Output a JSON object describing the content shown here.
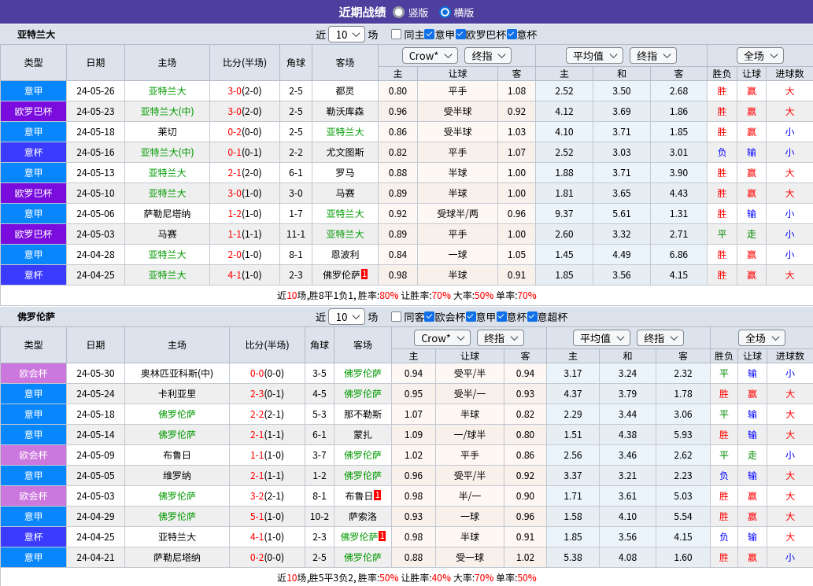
{
  "title_bar": {
    "title": "近期战绩",
    "radio_vertical": "竖版",
    "radio_horizontal": "横版",
    "selected": "横版"
  },
  "sections": [
    {
      "team": "亚特兰大",
      "recent_label": "近",
      "recent_count": "10",
      "matches_label": "场",
      "filters": [
        {
          "label": "同主",
          "checked": false
        },
        {
          "label": "意甲",
          "checked": true
        },
        {
          "label": "欧罗巴杯",
          "checked": true
        },
        {
          "label": "意杯",
          "checked": true
        }
      ],
      "columns": [
        "类型",
        "日期",
        "主场",
        "比分(半场)",
        "角球",
        "客场"
      ],
      "odds_dropdowns": [
        "Crow*",
        "终指"
      ],
      "avg_dropdowns": [
        "平均值",
        "终指"
      ],
      "scope_dropdown": "全场",
      "sub_columns": [
        "主",
        "让球",
        "客",
        "主",
        "和",
        "客",
        "胜负",
        "让球",
        "进球数"
      ],
      "rows": [
        {
          "type": "意甲",
          "type_color": "#0887FC",
          "date": "24-05-26",
          "home": "亚特兰大",
          "home_hl": true,
          "score": "3-0",
          "half": "(2-0)",
          "corner": "2-5",
          "away": "都灵",
          "away_hl": false,
          "odds": [
            "0.80",
            "平手",
            "1.08"
          ],
          "avg": [
            "2.52",
            "3.50",
            "2.68"
          ],
          "result": [
            "胜",
            "赢",
            "大"
          ],
          "result_colors": [
            "#FF0000",
            "#FF0000",
            "#FF0000"
          ]
        },
        {
          "type": "欧罗巴杯",
          "type_color": "#7A0CDE",
          "date": "24-05-23",
          "home": "亚特兰大(中)",
          "home_hl": true,
          "score": "3-0",
          "half": "(2-0)",
          "corner": "2-5",
          "away": "勒沃库森",
          "away_hl": false,
          "odds": [
            "0.96",
            "受半球",
            "0.92"
          ],
          "avg": [
            "4.12",
            "3.69",
            "1.86"
          ],
          "result": [
            "胜",
            "赢",
            "大"
          ],
          "result_colors": [
            "#FF0000",
            "#FF0000",
            "#FF0000"
          ]
        },
        {
          "type": "意甲",
          "type_color": "#0887FC",
          "date": "24-05-18",
          "home": "莱切",
          "home_hl": false,
          "score": "0-2",
          "half": "(0-0)",
          "corner": "2-5",
          "away": "亚特兰大",
          "away_hl": true,
          "odds": [
            "0.86",
            "受半球",
            "1.03"
          ],
          "avg": [
            "4.10",
            "3.71",
            "1.85"
          ],
          "result": [
            "胜",
            "赢",
            "小"
          ],
          "result_colors": [
            "#FF0000",
            "#FF0000",
            "#0000FF"
          ]
        },
        {
          "type": "意杯",
          "type_color": "#3B3BFE",
          "date": "24-05-16",
          "home": "亚特兰大(中)",
          "home_hl": true,
          "score": "0-1",
          "half": "(0-1)",
          "corner": "2-2",
          "away": "尤文图斯",
          "away_hl": false,
          "odds": [
            "0.82",
            "平手",
            "1.07"
          ],
          "avg": [
            "2.52",
            "3.03",
            "3.01"
          ],
          "result": [
            "负",
            "输",
            "小"
          ],
          "result_colors": [
            "#0000FF",
            "#0000FF",
            "#0000FF"
          ]
        },
        {
          "type": "意甲",
          "type_color": "#0887FC",
          "date": "24-05-13",
          "home": "亚特兰大",
          "home_hl": true,
          "score": "2-1",
          "half": "(2-0)",
          "corner": "6-1",
          "away": "罗马",
          "away_hl": false,
          "odds": [
            "0.88",
            "半球",
            "1.00"
          ],
          "avg": [
            "1.88",
            "3.71",
            "3.90"
          ],
          "result": [
            "胜",
            "赢",
            "大"
          ],
          "result_colors": [
            "#FF0000",
            "#FF0000",
            "#FF0000"
          ]
        },
        {
          "type": "欧罗巴杯",
          "type_color": "#7A0CDE",
          "date": "24-05-10",
          "home": "亚特兰大",
          "home_hl": true,
          "score": "3-0",
          "half": "(1-0)",
          "corner": "3-0",
          "away": "马赛",
          "away_hl": false,
          "odds": [
            "0.89",
            "半球",
            "1.00"
          ],
          "avg": [
            "1.81",
            "3.65",
            "4.43"
          ],
          "result": [
            "胜",
            "赢",
            "大"
          ],
          "result_colors": [
            "#FF0000",
            "#FF0000",
            "#FF0000"
          ]
        },
        {
          "type": "意甲",
          "type_color": "#0887FC",
          "date": "24-05-06",
          "home": "萨勒尼塔纳",
          "home_hl": false,
          "score": "1-2",
          "half": "(1-0)",
          "corner": "1-7",
          "away": "亚特兰大",
          "away_hl": true,
          "odds": [
            "0.92",
            "受球半/两",
            "0.96"
          ],
          "avg": [
            "9.37",
            "5.61",
            "1.31"
          ],
          "result": [
            "胜",
            "输",
            "小"
          ],
          "result_colors": [
            "#FF0000",
            "#0000FF",
            "#0000FF"
          ]
        },
        {
          "type": "欧罗巴杯",
          "type_color": "#7A0CDE",
          "date": "24-05-03",
          "home": "马赛",
          "home_hl": false,
          "score": "1-1",
          "half": "(1-1)",
          "corner": "11-1",
          "away": "亚特兰大",
          "away_hl": true,
          "odds": [
            "0.89",
            "平手",
            "1.00"
          ],
          "avg": [
            "2.60",
            "3.32",
            "2.71"
          ],
          "result": [
            "平",
            "走",
            "小"
          ],
          "result_colors": [
            "#008800",
            "#008800",
            "#0000FF"
          ]
        },
        {
          "type": "意甲",
          "type_color": "#0887FC",
          "date": "24-04-28",
          "home": "亚特兰大",
          "home_hl": true,
          "score": "2-0",
          "half": "(1-0)",
          "corner": "8-1",
          "away": "恩波利",
          "away_hl": false,
          "odds": [
            "0.84",
            "一球",
            "1.05"
          ],
          "avg": [
            "1.45",
            "4.49",
            "6.86"
          ],
          "result": [
            "胜",
            "赢",
            "小"
          ],
          "result_colors": [
            "#FF0000",
            "#FF0000",
            "#0000FF"
          ]
        },
        {
          "type": "意杯",
          "type_color": "#3B3BFE",
          "date": "24-04-25",
          "home": "亚特兰大",
          "home_hl": true,
          "score": "4-1",
          "half": "(1-0)",
          "corner": "2-3",
          "away": "佛罗伦萨",
          "away_hl": false,
          "away_badge": "1",
          "odds": [
            "0.98",
            "半球",
            "0.91"
          ],
          "avg": [
            "1.85",
            "3.56",
            "4.15"
          ],
          "result": [
            "胜",
            "赢",
            "大"
          ],
          "result_colors": [
            "#FF0000",
            "#FF0000",
            "#FF0000"
          ]
        }
      ],
      "summary": [
        {
          "text": "近",
          "color": "#000000"
        },
        {
          "text": "10",
          "color": "#FF0000"
        },
        {
          "text": "场,胜8平1负1, 胜率:",
          "color": "#000000"
        },
        {
          "text": "80%",
          "color": "#FF0000"
        },
        {
          "text": " 让胜率:",
          "color": "#000000"
        },
        {
          "text": "70%",
          "color": "#FF0000"
        },
        {
          "text": " 大率:",
          "color": "#000000"
        },
        {
          "text": "50%",
          "color": "#FF0000"
        },
        {
          "text": " 单率:",
          "color": "#000000"
        },
        {
          "text": "70%",
          "color": "#FF0000"
        }
      ]
    },
    {
      "team": "佛罗伦萨",
      "recent_label": "近",
      "recent_count": "10",
      "matches_label": "场",
      "filters": [
        {
          "label": "同客",
          "checked": false
        },
        {
          "label": "欧会杯",
          "checked": true
        },
        {
          "label": "意甲",
          "checked": true
        },
        {
          "label": "意杯",
          "checked": true
        },
        {
          "label": "意超杯",
          "checked": true
        }
      ],
      "columns": [
        "类型",
        "日期",
        "主场",
        "比分(半场)",
        "角球",
        "客场"
      ],
      "odds_dropdowns": [
        "Crow*",
        "终指"
      ],
      "avg_dropdowns": [
        "平均值",
        "终指"
      ],
      "scope_dropdown": "全场",
      "sub_columns": [
        "主",
        "让球",
        "客",
        "主",
        "和",
        "客",
        "胜负",
        "让球",
        "进球数"
      ],
      "rows": [
        {
          "type": "欧会杯",
          "type_color": "#CC77DD",
          "date": "24-05-30",
          "home": "奥林匹亚科斯(中)",
          "home_hl": false,
          "score": "0-0",
          "half": "(0-0)",
          "corner": "3-5",
          "away": "佛罗伦萨",
          "away_hl": true,
          "odds": [
            "0.94",
            "受平/半",
            "0.94"
          ],
          "avg": [
            "3.17",
            "3.24",
            "2.32"
          ],
          "result": [
            "平",
            "输",
            "小"
          ],
          "result_colors": [
            "#008800",
            "#0000FF",
            "#0000FF"
          ]
        },
        {
          "type": "意甲",
          "type_color": "#0887FC",
          "date": "24-05-24",
          "home": "卡利亚里",
          "home_hl": false,
          "score": "2-3",
          "half": "(0-1)",
          "corner": "4-5",
          "away": "佛罗伦萨",
          "away_hl": true,
          "odds": [
            "0.95",
            "受半/一",
            "0.93"
          ],
          "avg": [
            "4.37",
            "3.79",
            "1.78"
          ],
          "result": [
            "胜",
            "赢",
            "大"
          ],
          "result_colors": [
            "#FF0000",
            "#FF0000",
            "#FF0000"
          ]
        },
        {
          "type": "意甲",
          "type_color": "#0887FC",
          "date": "24-05-18",
          "home": "佛罗伦萨",
          "home_hl": true,
          "score": "2-2",
          "half": "(2-1)",
          "corner": "5-3",
          "away": "那不勒斯",
          "away_hl": false,
          "odds": [
            "1.07",
            "半球",
            "0.82"
          ],
          "avg": [
            "2.29",
            "3.44",
            "3.06"
          ],
          "result": [
            "平",
            "输",
            "大"
          ],
          "result_colors": [
            "#008800",
            "#0000FF",
            "#FF0000"
          ]
        },
        {
          "type": "意甲",
          "type_color": "#0887FC",
          "date": "24-05-14",
          "home": "佛罗伦萨",
          "home_hl": true,
          "score": "2-1",
          "half": "(1-1)",
          "corner": "6-1",
          "away": "蒙扎",
          "away_hl": false,
          "odds": [
            "1.09",
            "一/球半",
            "0.80"
          ],
          "avg": [
            "1.51",
            "4.38",
            "5.93"
          ],
          "result": [
            "胜",
            "输",
            "大"
          ],
          "result_colors": [
            "#FF0000",
            "#0000FF",
            "#FF0000"
          ]
        },
        {
          "type": "欧会杯",
          "type_color": "#CC77DD",
          "date": "24-05-09",
          "home": "布鲁日",
          "home_hl": false,
          "score": "1-1",
          "half": "(1-0)",
          "corner": "3-7",
          "away": "佛罗伦萨",
          "away_hl": true,
          "odds": [
            "1.02",
            "平手",
            "0.86"
          ],
          "avg": [
            "2.56",
            "3.46",
            "2.62"
          ],
          "result": [
            "平",
            "走",
            "小"
          ],
          "result_colors": [
            "#008800",
            "#008800",
            "#0000FF"
          ]
        },
        {
          "type": "意甲",
          "type_color": "#0887FC",
          "date": "24-05-05",
          "home": "维罗纳",
          "home_hl": false,
          "score": "2-1",
          "half": "(1-1)",
          "corner": "1-2",
          "away": "佛罗伦萨",
          "away_hl": true,
          "odds": [
            "0.96",
            "受平/半",
            "0.92"
          ],
          "avg": [
            "3.37",
            "3.21",
            "2.23"
          ],
          "result": [
            "负",
            "输",
            "大"
          ],
          "result_colors": [
            "#0000FF",
            "#0000FF",
            "#FF0000"
          ]
        },
        {
          "type": "欧会杯",
          "type_color": "#CC77DD",
          "date": "24-05-03",
          "home": "佛罗伦萨",
          "home_hl": true,
          "score": "3-2",
          "half": "(2-1)",
          "corner": "8-1",
          "away": "布鲁日",
          "away_hl": false,
          "away_badge": "1",
          "odds": [
            "0.98",
            "半/一",
            "0.90"
          ],
          "avg": [
            "1.71",
            "3.61",
            "5.03"
          ],
          "result": [
            "胜",
            "赢",
            "大"
          ],
          "result_colors": [
            "#FF0000",
            "#FF0000",
            "#FF0000"
          ]
        },
        {
          "type": "意甲",
          "type_color": "#0887FC",
          "date": "24-04-29",
          "home": "佛罗伦萨",
          "home_hl": true,
          "score": "5-1",
          "half": "(1-0)",
          "corner": "10-2",
          "away": "萨索洛",
          "away_hl": false,
          "odds": [
            "0.93",
            "一球",
            "0.96"
          ],
          "avg": [
            "1.58",
            "4.10",
            "5.54"
          ],
          "result": [
            "胜",
            "赢",
            "大"
          ],
          "result_colors": [
            "#FF0000",
            "#FF0000",
            "#FF0000"
          ]
        },
        {
          "type": "意杯",
          "type_color": "#3B3BFE",
          "date": "24-04-25",
          "home": "亚特兰大",
          "home_hl": false,
          "score": "4-1",
          "half": "(1-0)",
          "corner": "2-3",
          "away": "佛罗伦萨",
          "away_hl": true,
          "away_badge": "1",
          "odds": [
            "0.98",
            "半球",
            "0.91"
          ],
          "avg": [
            "1.85",
            "3.56",
            "4.15"
          ],
          "result": [
            "负",
            "输",
            "大"
          ],
          "result_colors": [
            "#0000FF",
            "#0000FF",
            "#FF0000"
          ]
        },
        {
          "type": "意甲",
          "type_color": "#0887FC",
          "date": "24-04-21",
          "home": "萨勒尼塔纳",
          "home_hl": false,
          "score": "0-2",
          "half": "(0-0)",
          "corner": "2-5",
          "away": "佛罗伦萨",
          "away_hl": true,
          "odds": [
            "0.88",
            "受一球",
            "1.02"
          ],
          "avg": [
            "5.38",
            "4.08",
            "1.60"
          ],
          "result": [
            "胜",
            "赢",
            "小"
          ],
          "result_colors": [
            "#FF0000",
            "#FF0000",
            "#0000FF"
          ]
        }
      ],
      "summary": [
        {
          "text": "近",
          "color": "#000000"
        },
        {
          "text": "10",
          "color": "#FF0000"
        },
        {
          "text": "场,胜5平3负2, 胜率:",
          "color": "#000000"
        },
        {
          "text": "50%",
          "color": "#FF0000"
        },
        {
          "text": " 让胜率:",
          "color": "#000000"
        },
        {
          "text": "40%",
          "color": "#FF0000"
        },
        {
          "text": " 大率:",
          "color": "#000000"
        },
        {
          "text": "70%",
          "color": "#FF0000"
        },
        {
          "text": " 单率:",
          "color": "#000000"
        },
        {
          "text": "50%",
          "color": "#FF0000"
        }
      ]
    }
  ]
}
